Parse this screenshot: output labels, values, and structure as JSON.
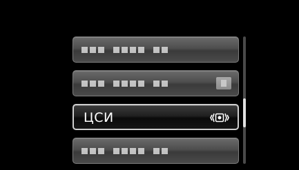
{
  "menu": {
    "items": [
      {
        "label": "",
        "state": "obscured"
      },
      {
        "label": "",
        "state": "obscured"
      },
      {
        "label": "ЦСИ",
        "state": "selected",
        "icon": "dis-vibration-icon"
      },
      {
        "label": "",
        "state": "obscured"
      }
    ]
  },
  "scrollbar": {
    "position": 0.5
  },
  "colors": {
    "background": "#000000",
    "selected_border": "#cfcfcf",
    "item_fill": "#555555",
    "label_text": "#ffffff"
  }
}
